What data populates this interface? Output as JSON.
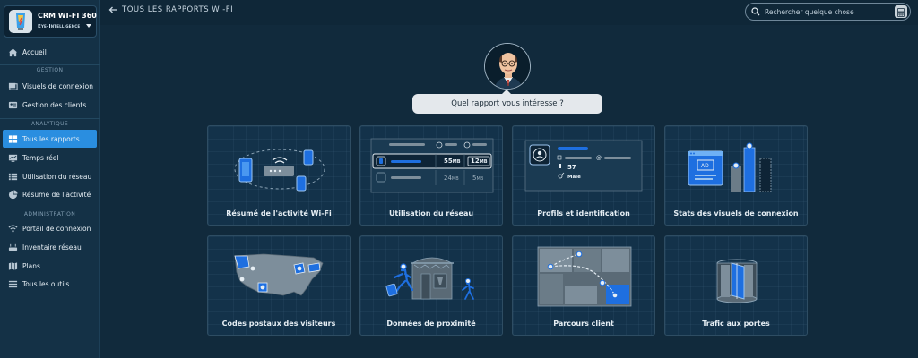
{
  "app": {
    "title": "CRM WI-FI 360",
    "subtitle": "Eye-Intelligence"
  },
  "sidebar": {
    "home": "Accueil",
    "sections": {
      "gestion": "GESTION",
      "analytique": "ANALYTIQUE",
      "administration": "ADMINISTRATION"
    },
    "items": [
      {
        "label": "Visuels de connexion",
        "icon": "image-icon"
      },
      {
        "label": "Gestion des clients",
        "icon": "users-icon"
      },
      {
        "label": "Tous les rapports",
        "icon": "grid-icon",
        "active": true
      },
      {
        "label": "Temps réel",
        "icon": "live-icon"
      },
      {
        "label": "Utilisation du réseau",
        "icon": "list-icon"
      },
      {
        "label": "Résumé de l'activité",
        "icon": "pie-icon"
      },
      {
        "label": "Portail de connexion",
        "icon": "wifi-icon"
      },
      {
        "label": "Inventaire réseau",
        "icon": "router-icon"
      },
      {
        "label": "Plans",
        "icon": "map-icon"
      },
      {
        "label": "Tous les outils",
        "icon": "menu-icon"
      }
    ]
  },
  "header": {
    "back_label": "TOUS LES RAPPORTS WI-FI",
    "search_placeholder": "Rechercher quelque chose"
  },
  "prompt": "Quel rapport vous intéresse ?",
  "cards": [
    {
      "label": "Résumé de l'activité Wi-Fi"
    },
    {
      "label": "Utilisation du réseau",
      "values": {
        "v1": "55",
        "u1": "MB",
        "v2": "12",
        "u2": "MB",
        "v3": "24",
        "u3": "MB",
        "v4": "5",
        "u4": "MB"
      }
    },
    {
      "label": "Profils et identification",
      "values": {
        "at": "@",
        "count": "57",
        "gender": "Male"
      }
    },
    {
      "label": "Stats des visuels de connexion",
      "values": {
        "ad": "AD"
      }
    },
    {
      "label": "Codes postaux des visiteurs"
    },
    {
      "label": "Données de proximité"
    },
    {
      "label": "Parcours client"
    },
    {
      "label": "Trafic aux portes"
    }
  ],
  "colors": {
    "accent": "#2a8ee0",
    "brand_blue": "#1e6fe0",
    "background": "#112a3c"
  }
}
